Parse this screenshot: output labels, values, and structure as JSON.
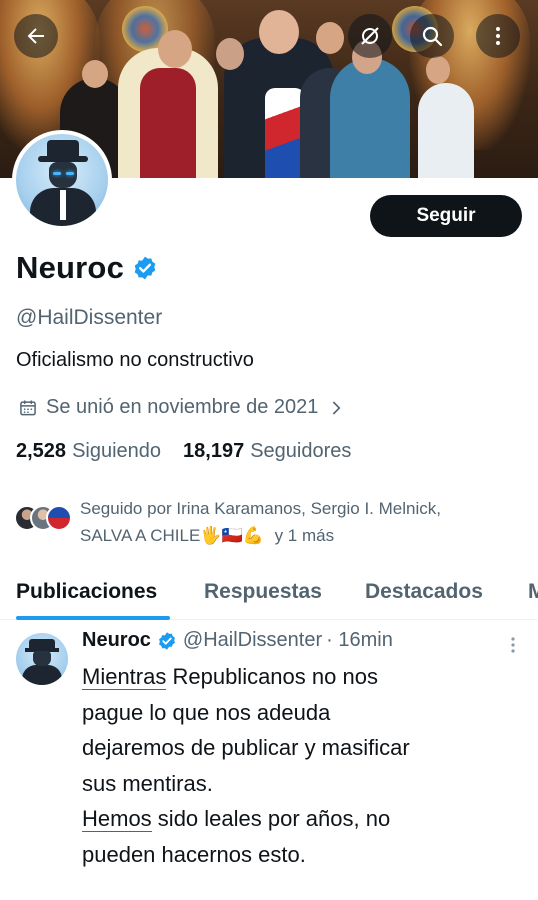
{
  "header": {
    "back_icon": "arrow-left-icon",
    "actions": [
      "no-sync-icon",
      "search-icon",
      "more-vertical-icon"
    ]
  },
  "profile": {
    "display_name": "Neuroc",
    "verified": true,
    "handle": "@HailDissenter",
    "bio": "Oficialismo no constructivo",
    "joined": "Se unió en noviembre de 2021",
    "follow_label": "Seguir",
    "following_count": "2,528",
    "following_label": "Siguiendo",
    "followers_count": "18,197",
    "followers_label": "Seguidores",
    "followed_by": {
      "prefix": "Seguido por Irina Karamanos, Sergio I. Melnick,",
      "line2": "SALVA A CHILE",
      "emojis": "🖐🇨🇱💪",
      "suffix": "y 1 más"
    }
  },
  "tabs": [
    {
      "label": "Publicaciones",
      "active": true
    },
    {
      "label": "Respuestas",
      "active": false
    },
    {
      "label": "Destacados",
      "active": false
    },
    {
      "label": "M",
      "active": false
    }
  ],
  "post": {
    "author": "Neuroc",
    "handle": "@HailDissenter",
    "time": "· 16min",
    "lines": [
      {
        "underlined": "Mientras",
        "rest": " Republicanos no nos"
      },
      {
        "underlined": "",
        "rest": "pague lo que nos adeuda"
      },
      {
        "underlined": "",
        "rest": "dejaremos de publicar y masificar"
      },
      {
        "underlined": "",
        "rest": "sus mentiras."
      },
      {
        "underlined": "Hemos",
        "rest": " sido leales por años, no"
      },
      {
        "underlined": "",
        "rest": "pueden hacernos esto."
      }
    ]
  },
  "colors": {
    "accent": "#1d9bf0",
    "text": "#0f1419",
    "muted": "#536471",
    "button": "#0f1419"
  }
}
